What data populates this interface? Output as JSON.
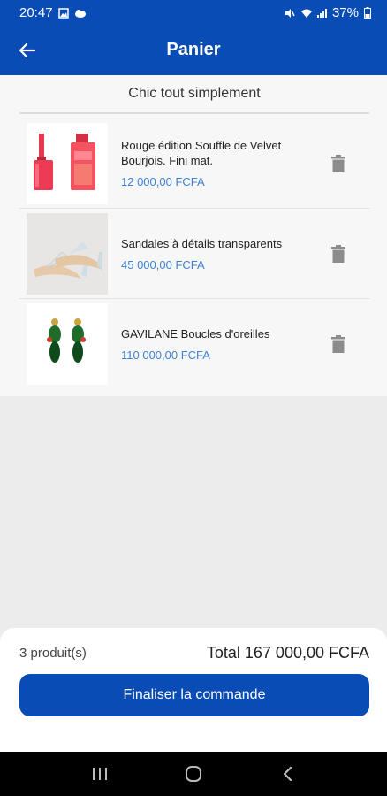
{
  "status_bar": {
    "time": "20:47",
    "battery": "37%",
    "left_icons": [
      "image-icon",
      "cloud-icon"
    ],
    "right_icons": [
      "mute-icon",
      "wifi-icon",
      "signal-icon",
      "battery-icon"
    ]
  },
  "app_bar": {
    "title": "Panier",
    "back_icon": "arrow-left-icon"
  },
  "section": {
    "title": "Chic tout simplement"
  },
  "cart": {
    "items": [
      {
        "name": "Rouge édition Souffle de Velvet Bourjois. Fini mat.",
        "price": "12 000,00 FCFA",
        "image": "lipstick"
      },
      {
        "name": "Sandales à détails transparents",
        "price": "45 000,00 FCFA",
        "image": "sandals"
      },
      {
        "name": "GAVILANE Boucles d'oreilles",
        "price": "110 000,00 FCFA",
        "image": "earrings"
      }
    ]
  },
  "summary": {
    "count": "3 produit(s)",
    "total": "Total 167 000,00 FCFA"
  },
  "cta": {
    "label": "Finaliser la commande"
  },
  "colors": {
    "primary": "#0a4cb5",
    "price": "#3f82d6",
    "background": "#ececec"
  }
}
